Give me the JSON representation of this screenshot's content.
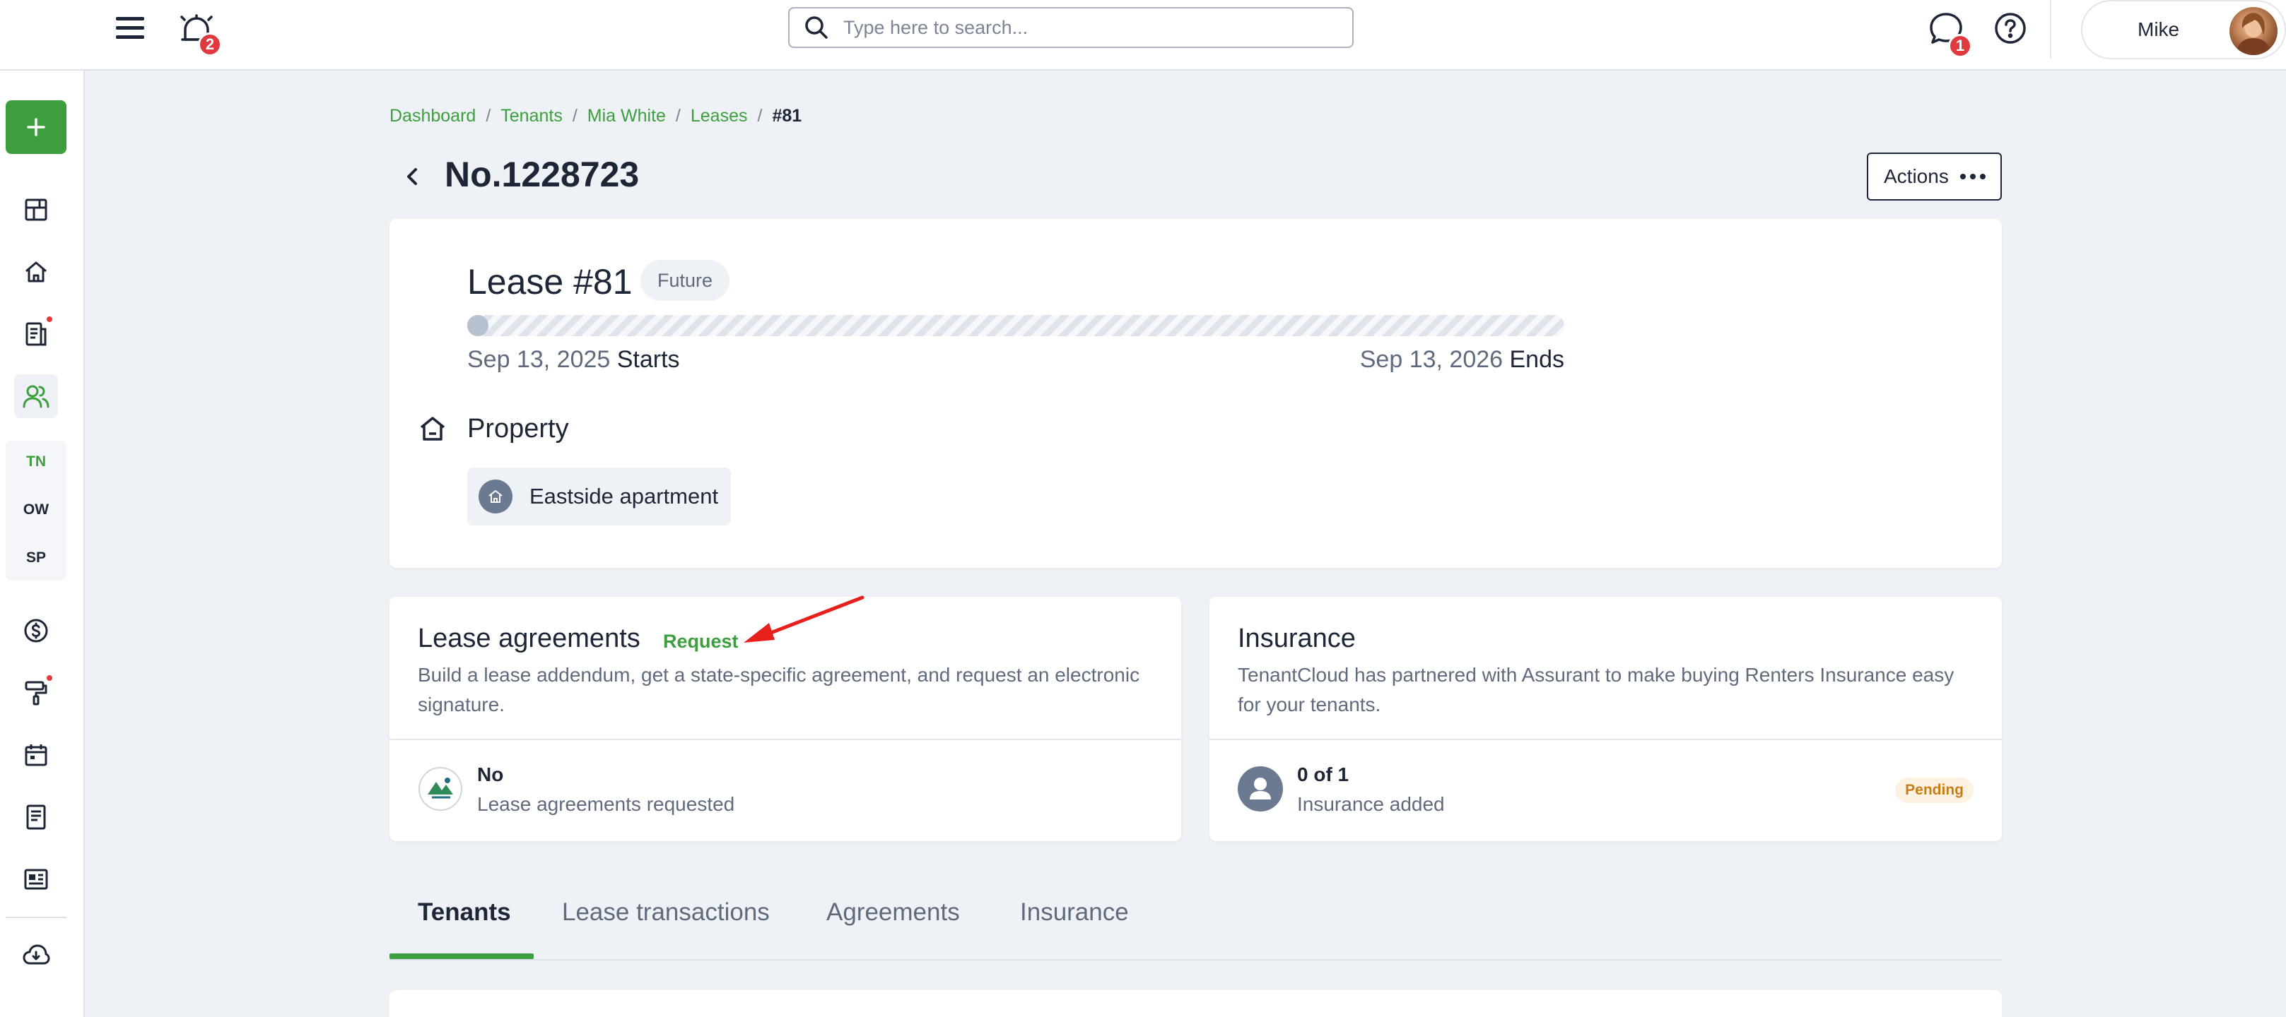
{
  "topbar": {
    "notifications_count": "2",
    "search_placeholder": "Type here to search...",
    "messages_count": "1",
    "user_name": "Mike"
  },
  "sidebar": {
    "sub_items": [
      "TN",
      "OW",
      "SP"
    ],
    "accent_color": "#3d9e3d"
  },
  "breadcrumb": {
    "items": [
      "Dashboard",
      "Tenants",
      "Mia White",
      "Leases"
    ],
    "current": "#81"
  },
  "header": {
    "title": "No.1228723",
    "actions_label": "Actions"
  },
  "lease": {
    "title": "Lease #81",
    "status": "Future",
    "progress": 0,
    "start_date": "Sep 13, 2025",
    "start_label": "Starts",
    "end_date": "Sep 13, 2026",
    "end_label": "Ends",
    "property_heading": "Property",
    "property_name": "Eastside apartment"
  },
  "agreements": {
    "title": "Lease agreements",
    "request_link": "Request",
    "description": "Build a lease addendum, get a state-specific agreement, and request an electronic signature.",
    "status_title": "No",
    "status_sub": "Lease agreements requested"
  },
  "insurance": {
    "title": "Insurance",
    "description": "TenantCloud has partnered with Assurant to make buying Renters Insurance easy for your tenants.",
    "status_title": "0 of 1",
    "status_sub": "Insurance added",
    "badge": "Pending"
  },
  "tabs": {
    "items": [
      "Tenants",
      "Lease transactions",
      "Agreements",
      "Insurance"
    ],
    "active_index": 0
  }
}
